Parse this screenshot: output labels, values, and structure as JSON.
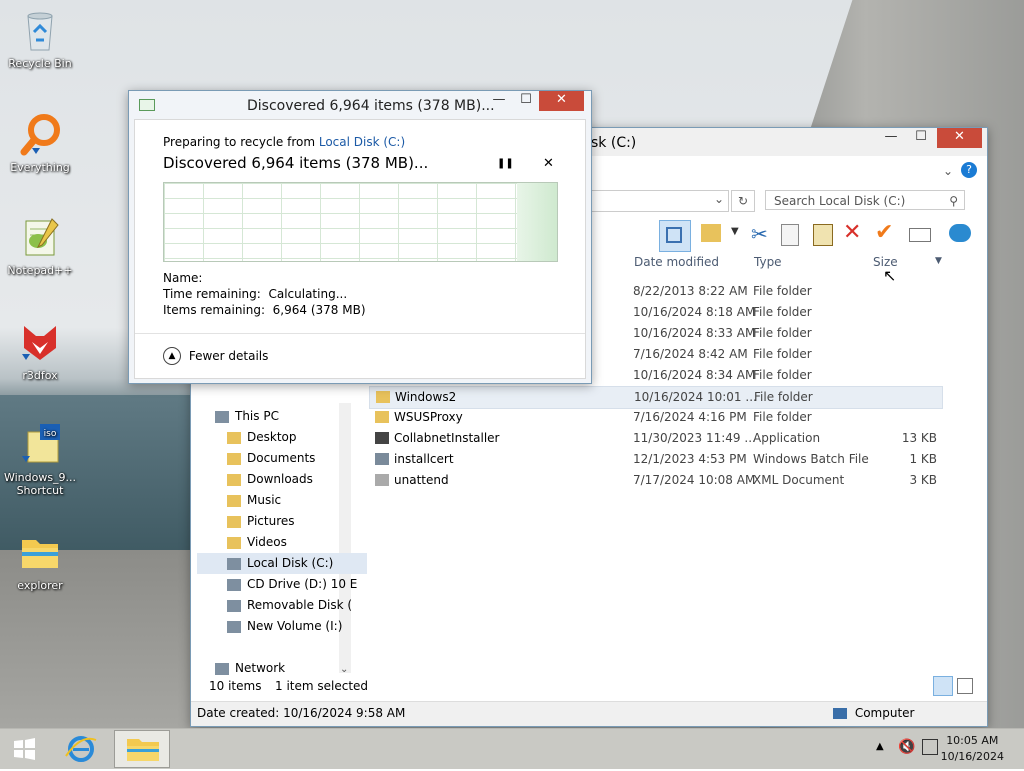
{
  "desktop": {
    "icons": [
      {
        "label": "Recycle Bin",
        "icon": "recycle-bin-icon"
      },
      {
        "label": "Everything",
        "icon": "everything-search-icon"
      },
      {
        "label": "Notepad++",
        "icon": "notepad-plus-plus-icon"
      },
      {
        "label": "r3dfox",
        "icon": "r3dfox-browser-icon"
      },
      {
        "label": "Windows_9...",
        "label2": "Shortcut",
        "icon": "iso-shortcut-icon"
      },
      {
        "label": "explorer",
        "icon": "folder-icon"
      }
    ]
  },
  "dialog": {
    "title": "Discovered 6,964 items (378 MB)...",
    "preparing_prefix": "Preparing to recycle from ",
    "preparing_link": "Local Disk (C:)",
    "heading": "Discovered 6,964 items (378 MB)...",
    "name_label": "Name:",
    "time_label": "Time remaining:",
    "time_value": "Calculating...",
    "items_label": "Items remaining:",
    "items_value": "6,964 (378 MB)",
    "fewer_details": "Fewer details",
    "pause_glyph": "❚❚",
    "cancel_glyph": "✕"
  },
  "explorer": {
    "title": "sk (C:)",
    "search_placeholder": "Search Local Disk (C:)",
    "columns": {
      "date": "Date modified",
      "type": "Type",
      "size": "Size"
    },
    "files": [
      {
        "name": "",
        "date": "8/22/2013 8:22 AM",
        "type": "File folder",
        "size": "",
        "icon": "folder-icon"
      },
      {
        "name": "",
        "date": "10/16/2024 8:18 AM",
        "type": "File folder",
        "size": "",
        "icon": "folder-icon"
      },
      {
        "name": "",
        "date": "10/16/2024 8:33 AM",
        "type": "File folder",
        "size": "",
        "icon": "folder-icon"
      },
      {
        "name": "",
        "date": "7/16/2024 8:42 AM",
        "type": "File folder",
        "size": "",
        "icon": "folder-icon"
      },
      {
        "name": "",
        "date": "10/16/2024 8:34 AM",
        "type": "File folder",
        "size": "",
        "icon": "folder-icon"
      },
      {
        "name": "Windows2",
        "date": "10/16/2024 10:01 ...",
        "type": "File folder",
        "size": "",
        "icon": "folder-icon",
        "selected": true
      },
      {
        "name": "WSUSProxy",
        "date": "7/16/2024 4:16 PM",
        "type": "File folder",
        "size": "",
        "icon": "folder-icon"
      },
      {
        "name": "CollabnetInstaller",
        "date": "11/30/2023 11:49 ...",
        "type": "Application",
        "size": "13 KB",
        "icon": "application-icon"
      },
      {
        "name": "installcert",
        "date": "12/1/2023 4:53 PM",
        "type": "Windows Batch File",
        "size": "1 KB",
        "icon": "batch-file-icon"
      },
      {
        "name": "unattend",
        "date": "7/17/2024 10:08 AM",
        "type": "XML Document",
        "size": "3 KB",
        "icon": "xml-file-icon"
      }
    ],
    "nav": [
      {
        "label": "This PC",
        "icon": "pc-icon"
      },
      {
        "label": "Desktop",
        "icon": "desktop-folder-icon"
      },
      {
        "label": "Documents",
        "icon": "documents-folder-icon"
      },
      {
        "label": "Downloads",
        "icon": "downloads-folder-icon"
      },
      {
        "label": "Music",
        "icon": "music-folder-icon"
      },
      {
        "label": "Pictures",
        "icon": "pictures-folder-icon"
      },
      {
        "label": "Videos",
        "icon": "videos-folder-icon"
      },
      {
        "label": "Local Disk (C:)",
        "icon": "local-disk-icon",
        "selected": true
      },
      {
        "label": "CD Drive (D:) 10 E",
        "icon": "cd-drive-icon"
      },
      {
        "label": "Removable Disk (",
        "icon": "removable-disk-icon"
      },
      {
        "label": "New Volume (I:)",
        "icon": "drive-icon"
      },
      {
        "label": "Network",
        "icon": "network-icon"
      }
    ],
    "status": {
      "items": "10 items",
      "selected": "1 item selected",
      "date_created": "Date created: 10/16/2024 9:58 AM",
      "computer": "Computer"
    }
  },
  "taskbar": {
    "time": "10:05 AM",
    "date": "10/16/2024"
  },
  "colors": {
    "close_red": "#c94b3a",
    "link_blue": "#1c5aa6",
    "graph_green": "#cfe9cf",
    "taskbar": "#c9c9c4"
  }
}
